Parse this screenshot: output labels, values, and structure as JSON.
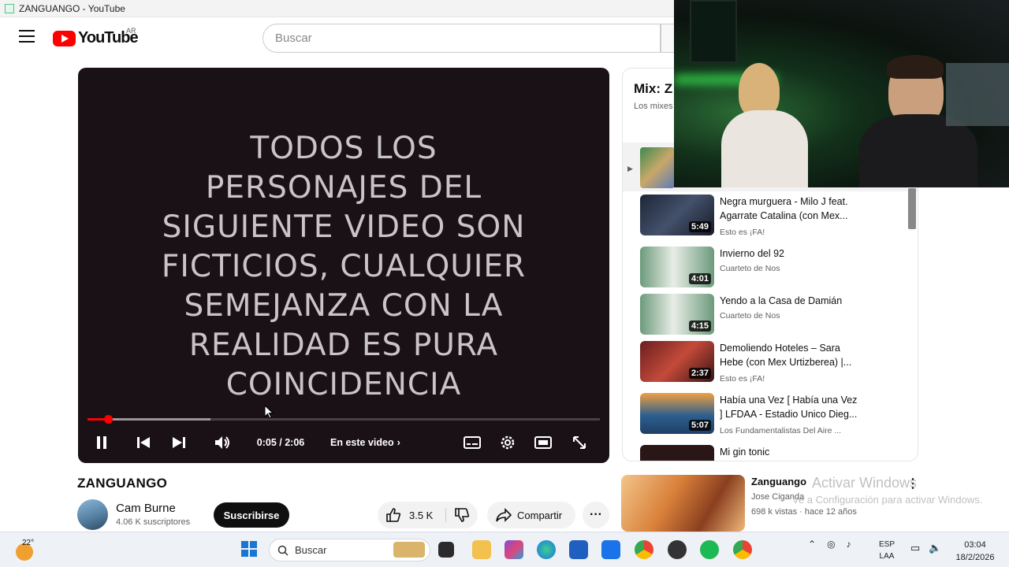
{
  "window": {
    "title": "ZANGUANGO - YouTube"
  },
  "header": {
    "logo_text": "YouTube",
    "country_code": "AR",
    "search_placeholder": "Buscar"
  },
  "player": {
    "overlay_text": [
      "TODOS LOS",
      "PERSONAJES DEL",
      "SIGUIENTE VIDEO SON",
      "FICTICIOS, CUALQUIER",
      "SEMEJANZA CON LA",
      "REALIDAD ES PURA",
      "COINCIDENCIA"
    ],
    "time_display": "0:05 / 2:06",
    "chapters_label": "En este video",
    "progress_played_fraction": 0.04,
    "progress_buffered_fraction": 0.24
  },
  "video": {
    "title": "ZANGUANGO",
    "channel": "Cam Burne",
    "subscribers": "4.06 K suscriptores",
    "subscribe_label": "Suscribirse",
    "likes": "3.5 K",
    "share_label": "Compartir"
  },
  "playlist": {
    "title": "Mix: Z",
    "subtitle": "Los mixes",
    "items": [
      {
        "title": "Negra murguera - Milo J feat. Agarrate Catalina (con Mex...",
        "channel": "Esto es ¡FA!",
        "duration": "5:49",
        "thumb_color": "#2d3b52"
      },
      {
        "title": "Invierno del 92",
        "channel": "Cuarteto de Nos",
        "duration": "4:01",
        "thumb_color": "#5f8f6f"
      },
      {
        "title": "Yendo a la Casa de Damián",
        "channel": "Cuarteto de Nos",
        "duration": "4:15",
        "thumb_color": "#5f8f6f"
      },
      {
        "title": "Demoliendo Hoteles – Sara Hebe (con Mex Urtizberea) |...",
        "channel": "Esto es ¡FA!",
        "duration": "2:37",
        "thumb_color": "#7a2c2a"
      },
      {
        "title": "Había una Vez [ Había una Vez ] LFDAA - Estadio Unico Dieg...",
        "channel": "Los Fundamentalistas Del Aire ...",
        "duration": "5:07",
        "thumb_color": "#3a6a9a"
      },
      {
        "title": "Mi gin tonic",
        "channel": "",
        "duration": "",
        "thumb_color": "#2a1616"
      }
    ]
  },
  "recommended": {
    "title": "Zanguango",
    "channel": "Jose Ciganda",
    "meta": "698 k vistas · hace 12 años"
  },
  "watermark": {
    "line1": "Activar Windows",
    "line2": "Ve a Configuración para activar Windows."
  },
  "taskbar": {
    "weather_temp": "22°",
    "search_placeholder": "Buscar",
    "lang_line1": "ESP",
    "lang_line2": "LAA",
    "time": "03:04",
    "date": "18/2/2026"
  }
}
